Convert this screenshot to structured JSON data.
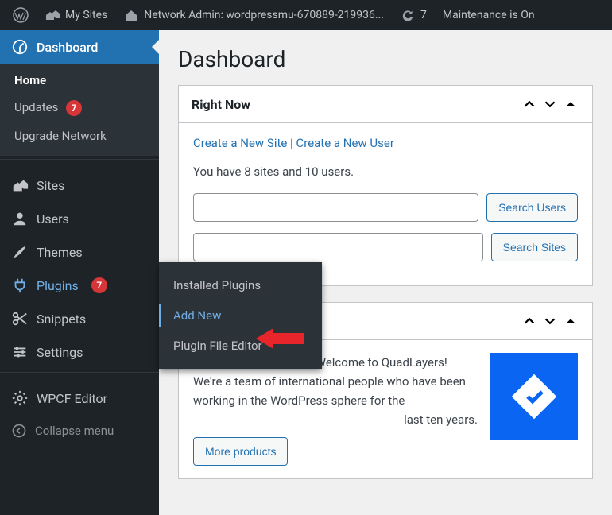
{
  "adminbar": {
    "my_sites": "My Sites",
    "network_admin": "Network Admin: wordpressmu-670889-219936...",
    "updates_count": "7",
    "maintenance": "Maintenance is On"
  },
  "sidebar": {
    "dashboard": "Dashboard",
    "submenu": {
      "home": "Home",
      "updates": "Updates",
      "updates_count": "7",
      "upgrade_network": "Upgrade Network"
    },
    "sites": "Sites",
    "users": "Users",
    "themes": "Themes",
    "plugins": "Plugins",
    "plugins_count": "7",
    "snippets": "Snippets",
    "settings": "Settings",
    "wpcf_editor": "WPCF Editor",
    "collapse": "Collapse menu"
  },
  "flyout": {
    "installed": "Installed Plugins",
    "add_new": "Add New",
    "editor": "Plugin File Editor"
  },
  "page": {
    "title": "Dashboard"
  },
  "right_now": {
    "title": "Right Now",
    "create_site": "Create a New Site",
    "sep": " | ",
    "create_user": "Create a New User",
    "stats": "You have 8 sites and 10 users.",
    "search_users_btn": "Search Users",
    "search_sites_btn": "Search Sites"
  },
  "quadlayers": {
    "text_a": "Hi! We are Quadlayers! Welcome to QuadLayers! We're a team of international people who have been working in the WordPress sphere for the",
    "text_b": "last ten years.",
    "more_products": "More products"
  }
}
